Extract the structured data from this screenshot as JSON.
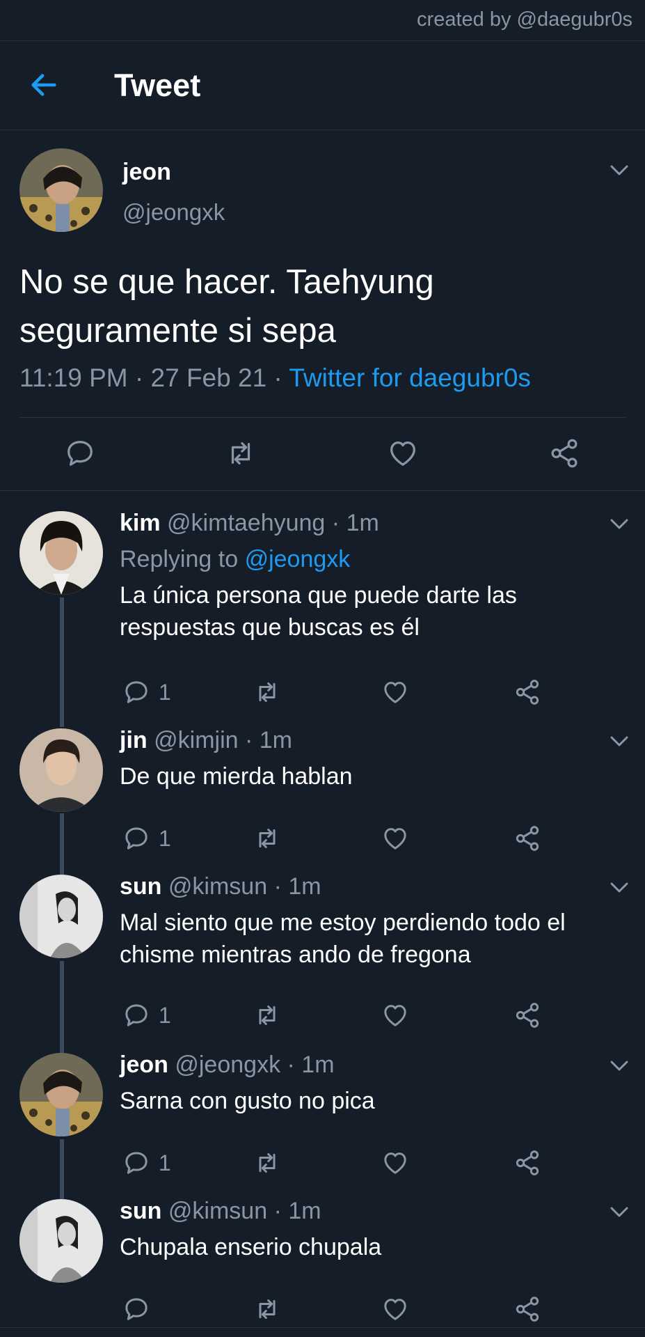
{
  "watermark": "created by @daegubr0s",
  "header": {
    "title": "Tweet",
    "back_icon": "arrow-left-icon"
  },
  "colors": {
    "background": "#151d28",
    "accent": "#1d9bf0",
    "muted": "#8a96a3",
    "divider": "#2a3441"
  },
  "tweet": {
    "name": "jeon",
    "handle": "@jeongxk",
    "text": "No se que hacer. Taehyung seguramente si sepa",
    "time": "11:19 PM",
    "date": "27 Feb 21",
    "sep": " · ",
    "source": "Twitter for daegubr0s",
    "actions": [
      "reply-icon",
      "retweet-icon",
      "like-icon",
      "share-icon"
    ]
  },
  "replies": [
    {
      "name": "kim",
      "handle": "@kimtaehyung",
      "time": "1m",
      "replying_label": "Replying to",
      "replying_to": "@jeongxk",
      "text": "La única persona que puede darte las respuestas que buscas es él",
      "reply_count": "1"
    },
    {
      "name": "jin",
      "handle": "@kimjin",
      "time": "1m",
      "text": "De que mierda hablan",
      "reply_count": "1"
    },
    {
      "name": "sun",
      "handle": "@kimsun",
      "time": "1m",
      "text": "Mal siento que me estoy perdiendo todo el chisme mientras ando de fregona",
      "reply_count": "1"
    },
    {
      "name": "jeon",
      "handle": "@jeongxk",
      "time": "1m",
      "text": "Sarna con gusto no pica",
      "reply_count": "1"
    },
    {
      "name": "sun",
      "handle": "@kimsun",
      "time": "1m",
      "text": "Chupala enserio chupala",
      "reply_count": ""
    }
  ]
}
